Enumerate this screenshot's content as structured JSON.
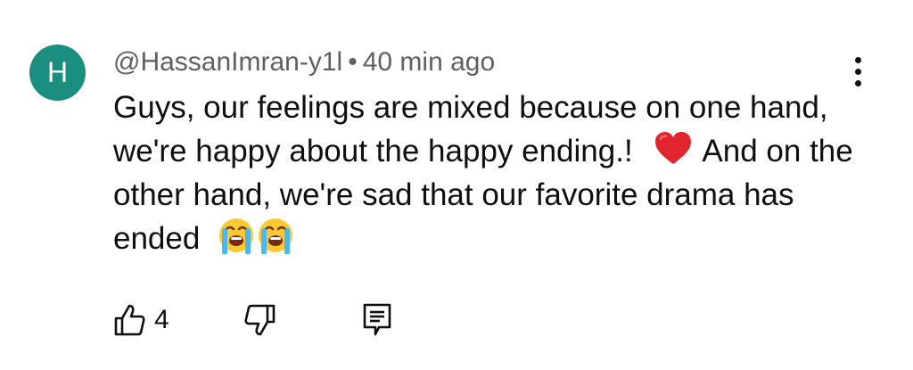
{
  "comment": {
    "avatar_initial": "H",
    "avatar_color": "#1a8f7f",
    "author": "@HassanImran-y1l",
    "separator": "•",
    "time": "40 min ago",
    "body_lines": [
      "Guys, our feelings are mixed because on one hand,",
      "we're happy about the happy ending.!",
      "And on the",
      "other hand, we're sad that our favorite drama has",
      "ended"
    ],
    "emojis": {
      "heart": "red-heart-emoji",
      "crying": "loudly-crying-face-emoji"
    }
  },
  "actions": {
    "like_count": "4",
    "like_icon": "thumbs-up-icon",
    "dislike_icon": "thumbs-down-icon",
    "reply_icon": "reply-comment-icon"
  },
  "menu_icon": "more-vertical-icon"
}
